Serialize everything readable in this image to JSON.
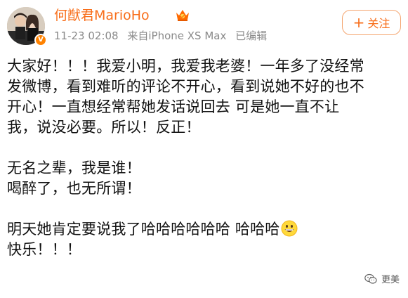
{
  "header": {
    "user_name": "何猷君MarioHo",
    "timestamp": "11-23 02:08",
    "source": "来自iPhone XS Max",
    "edited": "已编辑",
    "follow_label": "关注",
    "follow_icon": "plus-icon",
    "avatar_icon": "avatar-photo",
    "badge_icon": "verified-v-icon",
    "member_icon": "vip-crown-icon",
    "colors": {
      "name": "#f86e1a",
      "meta": "#8a8a8a",
      "follow_border": "#f4a46e"
    }
  },
  "post": {
    "lines": [
      "大家好！！！我爱小明，我爱我老婆！一年多了没经常",
      "发微博，看到难听的评论不开心，看到说她不好的也不",
      "开心！一直想经常帮她发话说回去 可是她一直不让",
      "我，说没必要。所以！反正！",
      "",
      "无名之辈，我是谁！",
      "喝醉了，也无所谓！",
      "",
      "明天她肯定要说我了哈哈哈哈哈哈 哈哈哈",
      "快乐！！！"
    ],
    "emoji": "grinning-face-emoji"
  },
  "watermark": {
    "label": "更美",
    "icon": "wechat-icon"
  }
}
